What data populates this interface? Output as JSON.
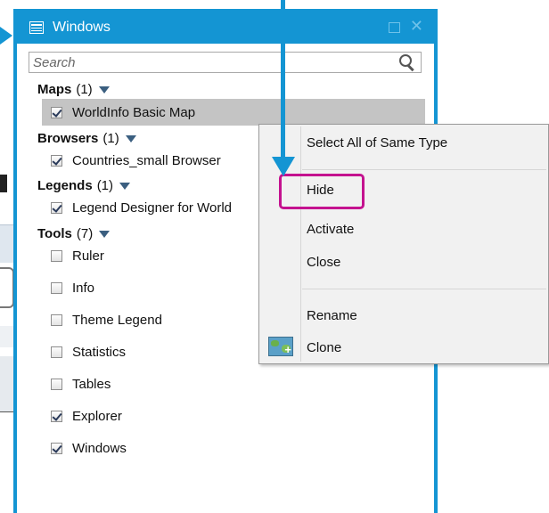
{
  "window": {
    "title": "Windows",
    "search_placeholder": "Search"
  },
  "groups": [
    {
      "name": "Maps",
      "count": "(1)",
      "items": [
        {
          "label": "WorldInfo Basic Map",
          "checked": true,
          "selected": true
        }
      ]
    },
    {
      "name": "Browsers",
      "count": "(1)",
      "items": [
        {
          "label": "Countries_small Browser",
          "checked": true
        }
      ]
    },
    {
      "name": "Legends",
      "count": "(1)",
      "items": [
        {
          "label": "Legend Designer for World",
          "checked": true
        }
      ]
    },
    {
      "name": "Tools",
      "count": "(7)",
      "items": [
        {
          "label": "Ruler",
          "checked": false
        },
        {
          "label": "Info",
          "checked": false
        },
        {
          "label": "Theme Legend",
          "checked": false
        },
        {
          "label": "Statistics",
          "checked": false
        },
        {
          "label": "Tables",
          "checked": false
        },
        {
          "label": "Explorer",
          "checked": true
        },
        {
          "label": "Windows",
          "checked": true
        }
      ]
    }
  ],
  "context_menu": {
    "items": [
      {
        "label": "Select All of Same Type"
      },
      {
        "label": "Hide"
      },
      {
        "label": "Activate"
      },
      {
        "label": "Close"
      },
      {
        "label": "Rename"
      },
      {
        "label": "Clone",
        "icon": "map-clone-icon"
      }
    ]
  },
  "colors": {
    "accent_blue": "#1495d3",
    "highlight_magenta": "#c4128f",
    "selected_row": "#c4c4c4",
    "menu_bg": "#f1f1f1"
  }
}
